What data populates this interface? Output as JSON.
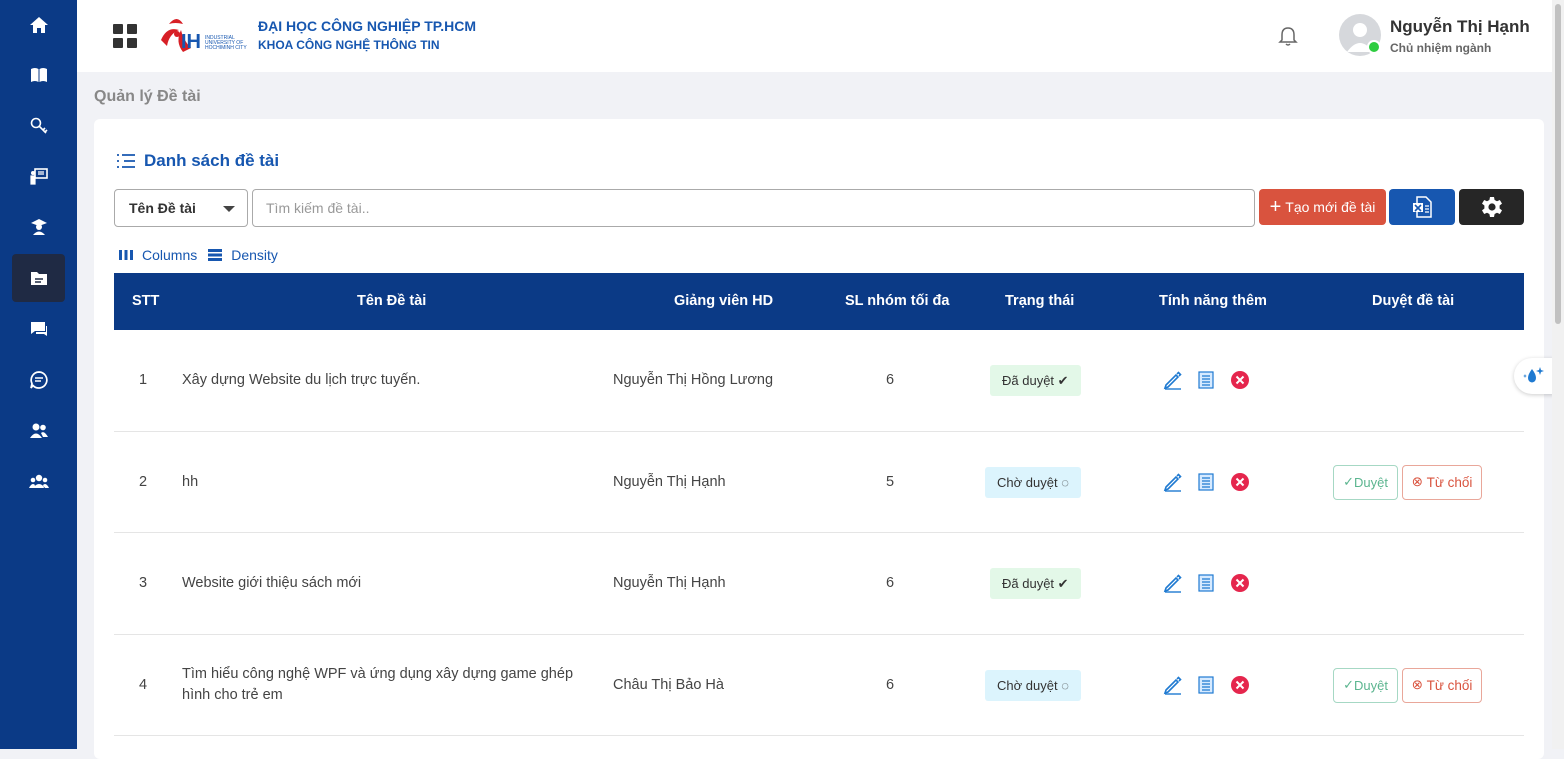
{
  "sidebar": {
    "items": [
      {
        "icon": "home-icon"
      },
      {
        "icon": "book-icon"
      },
      {
        "icon": "key-icon"
      },
      {
        "icon": "presentation-icon"
      },
      {
        "icon": "graduate-icon"
      },
      {
        "icon": "folder-icon",
        "active": true
      },
      {
        "icon": "chat-icon"
      },
      {
        "icon": "document-chat-icon"
      },
      {
        "icon": "users-icon"
      },
      {
        "icon": "group-icon"
      }
    ]
  },
  "header": {
    "university_name": "ĐẠI HỌC CÔNG NGHIỆP TP.HCM",
    "faculty_name": "KHOA CÔNG NGHỆ THÔNG TIN",
    "user_name": "Nguyễn Thị Hạnh",
    "user_role": "Chủ nhiệm ngành"
  },
  "page_title": "Quản lý Đề tài",
  "card": {
    "title": "Danh sách đề tài",
    "filter_selected": "Tên Đề tài",
    "search_placeholder": "Tìm kiếm đề tài..",
    "create_label": "Tạo mới đề tài",
    "columns_label": "Columns",
    "density_label": "Density"
  },
  "table": {
    "headers": [
      "STT",
      "Tên Đề tài",
      "Giảng viên HD",
      "SL nhóm tối đa",
      "Trạng thái",
      "Tính năng thêm",
      "Duyệt đề tài"
    ],
    "rows": [
      {
        "stt": "1",
        "title": "Xây dựng Website du lịch trực tuyến.",
        "title2": "",
        "lecturer": "Nguyễn Thị Hồng Lương",
        "max_groups": "6",
        "status": "Đã duyệt",
        "status_type": "approved"
      },
      {
        "stt": "2",
        "title": "hh",
        "title2": "",
        "lecturer": "Nguyễn Thị Hạnh",
        "max_groups": "5",
        "status": "Chờ duyệt",
        "status_type": "pending"
      },
      {
        "stt": "3",
        "title": "Website giới thiệu sách mới",
        "title2": "",
        "lecturer": "Nguyễn Thị Hạnh",
        "max_groups": "6",
        "status": "Đã duyệt",
        "status_type": "approved"
      },
      {
        "stt": "4",
        "title": "Tìm hiểu công nghệ WPF và ứng dụng xây dựng game ghép",
        "title2": "hình cho trẻ em",
        "lecturer": "Châu Thị Bảo Hà",
        "max_groups": "6",
        "status": "Chờ duyệt",
        "status_type": "pending"
      }
    ],
    "approve_label": "Duyệt",
    "reject_label": "Từ chối"
  }
}
